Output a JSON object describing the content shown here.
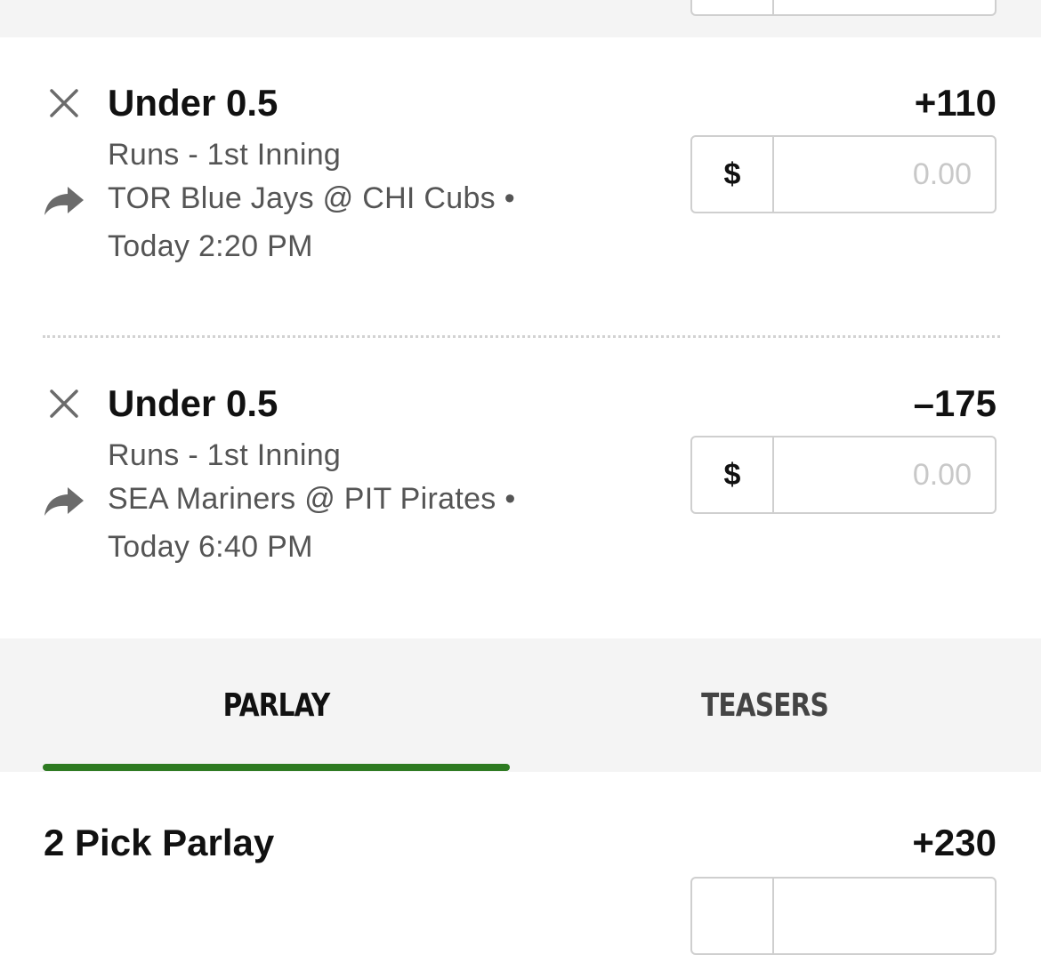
{
  "bets": [
    {
      "selection": "Under 0.5",
      "odds": "+110",
      "market": "Runs - 1st Inning",
      "matchup": "TOR Blue Jays @ CHI Cubs •",
      "time": "Today 2:20 PM",
      "currency": "$",
      "stake_placeholder": "0.00"
    },
    {
      "selection": "Under 0.5",
      "odds": "–175",
      "market": "Runs - 1st Inning",
      "matchup": "SEA Mariners @ PIT Pirates •",
      "time": "Today 6:40 PM",
      "currency": "$",
      "stake_placeholder": "0.00"
    }
  ],
  "tabs": {
    "parlay": "PARLAY",
    "teasers": "TEASERS",
    "active": "parlay",
    "accent_color": "#2d7a21"
  },
  "parlay": {
    "title": "2 Pick Parlay",
    "odds": "+230"
  },
  "icons": {
    "remove": "close-icon",
    "share": "share-arrow-icon"
  }
}
